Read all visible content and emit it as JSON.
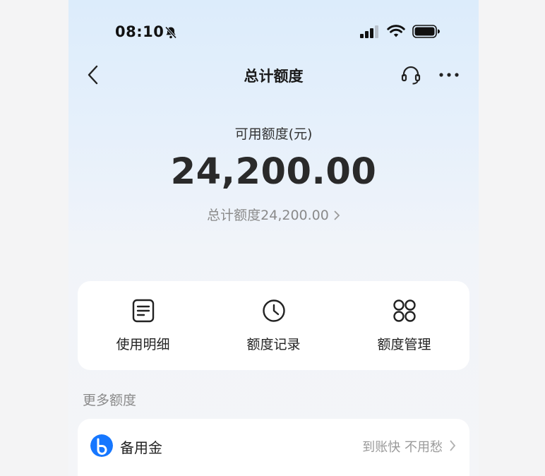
{
  "status_bar": {
    "time": "08:10"
  },
  "nav": {
    "title": "总计额度"
  },
  "balance": {
    "label": "可用额度(元)",
    "amount": "24,200.00",
    "total_link": "总计额度24,200.00"
  },
  "actions": [
    {
      "label": "使用明细",
      "icon": "list-icon"
    },
    {
      "label": "额度记录",
      "icon": "clock-icon"
    },
    {
      "label": "额度管理",
      "icon": "grid-icon"
    }
  ],
  "more_section": {
    "title": "更多额度",
    "items": [
      {
        "name": "备用金",
        "desc": "到账快 不用愁",
        "icon": "b-logo-icon"
      }
    ]
  },
  "colors": {
    "brand_blue": "#1677ff",
    "bg_top": "#dcecfb"
  }
}
